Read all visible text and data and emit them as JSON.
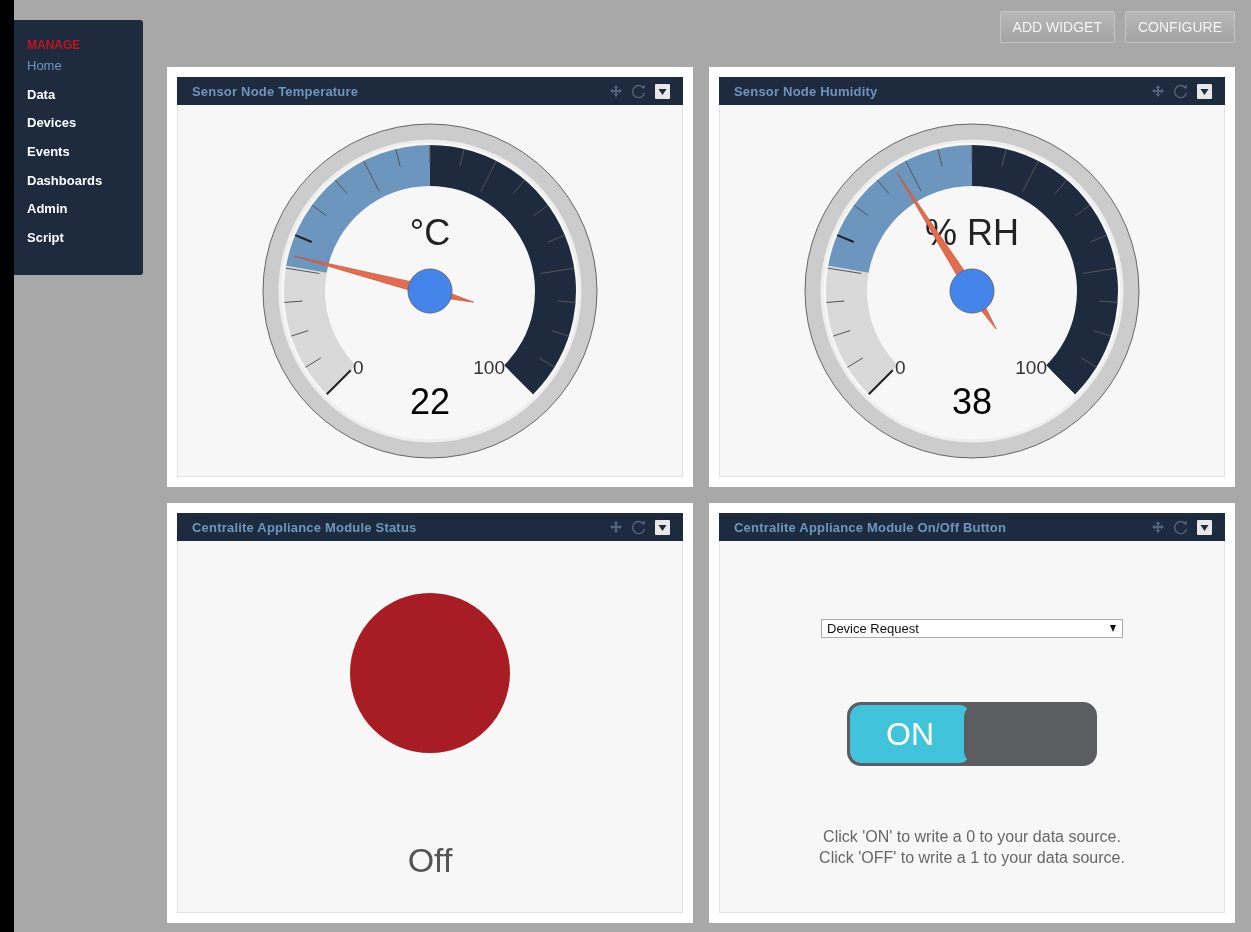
{
  "sidebar": {
    "heading": "MANAGE",
    "items": [
      {
        "label": "Home",
        "selected": true
      },
      {
        "label": "Data",
        "selected": false
      },
      {
        "label": "Devices",
        "selected": false
      },
      {
        "label": "Events",
        "selected": false
      },
      {
        "label": "Dashboards",
        "selected": false
      },
      {
        "label": "Admin",
        "selected": false
      },
      {
        "label": "Script",
        "selected": false
      }
    ]
  },
  "toolbar": {
    "buttons": [
      "ADD WIDGET",
      "CONFIGURE"
    ]
  },
  "widgets": [
    {
      "kind": "gauge",
      "title": "Sensor Node Temperature",
      "unit": "°C",
      "value": "22",
      "min_label": "0",
      "max_label": "100"
    },
    {
      "kind": "gauge",
      "title": "Sensor Node Humidity",
      "unit": "% RH",
      "value": "38",
      "min_label": "0",
      "max_label": "100"
    },
    {
      "kind": "status",
      "title": "Centralite Appliance Module Status",
      "on": false,
      "label": "Off"
    },
    {
      "kind": "switch",
      "title": "Centralite Appliance Module On/Off Button",
      "select_value": "Device Request",
      "on": true,
      "switch_label": "ON",
      "help": [
        "Click 'ON' to write a 0 to your data source.",
        "Click 'OFF' to write a 1 to your data source."
      ]
    }
  ]
}
